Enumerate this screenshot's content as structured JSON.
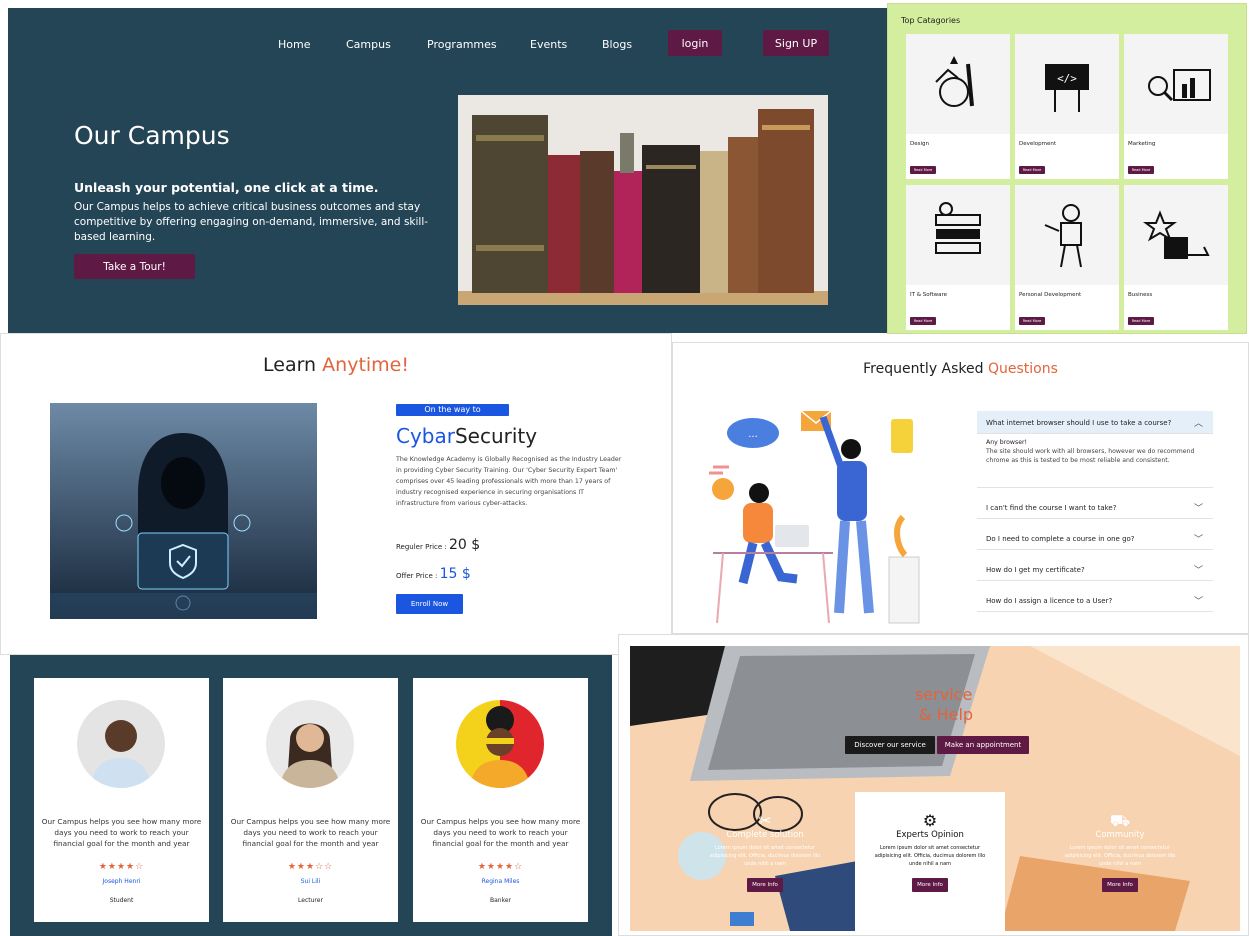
{
  "hero": {
    "nav": [
      "Home",
      "Campus",
      "Programmes",
      "Events",
      "Blogs"
    ],
    "login": "login",
    "signup": "Sign UP",
    "title": "Our Campus",
    "tagline": "Unleash your potential, one click at a time.",
    "description": "Our Campus helps to achieve critical business outcomes and stay competitive by offering engaging on-demand, immersive, and skill-based learning.",
    "cta": "Take a Tour!"
  },
  "categories": {
    "title": "Top Catagories",
    "items": [
      {
        "label": "Design",
        "button": "Read More"
      },
      {
        "label": "Development",
        "button": "Read More"
      },
      {
        "label": "Marketing",
        "button": "Read More"
      },
      {
        "label": "IT & Software",
        "button": "Read More"
      },
      {
        "label": "Personal Development",
        "button": "Read More"
      },
      {
        "label": "Business",
        "button": "Read More"
      }
    ]
  },
  "learn": {
    "title_a": "Learn ",
    "title_b": "Anytime!",
    "pill": "On the way to",
    "course_a": "Cybar",
    "course_b": "Security",
    "description": "The Knowledge Academy is Globally Recognised as the Industry Leader in providing Cyber Security Training. Our 'Cyber Security Expert Team' comprises over 45 leading professionals with more than 17 years of industry recognised experience in securing organisations IT infrastructure from various cyber-attacks.",
    "regular_label": "Reguler Price : ",
    "regular_value": "20 $",
    "offer_label": "Offer Price : ",
    "offer_value": "15 $",
    "enroll": "Enroll Now"
  },
  "faq": {
    "title_a": "Frequently Asked ",
    "title_b": "Questions",
    "open_q": "What internet browser should I use to take a course?",
    "answer_head": "Any browser!",
    "answer_body": "The site should work with all browsers, however we do recommend chrome as this is tested to be most reliable and consistent.",
    "questions": [
      "I can't find the course I want to take?",
      "Do I need to complete a course in one go?",
      "How do I get my certificate?",
      "How do I assign a licence to a User?"
    ]
  },
  "testimonials": [
    {
      "quote": "Our Campus helps you see how many more days you need to work to reach your financial goal for the month and year",
      "stars": "★★★★☆",
      "name": "Joseph Henri",
      "role": "Student"
    },
    {
      "quote": "Our Campus helps you see how many more days you need to work to reach your financial goal for the month and year",
      "stars": "★★★☆☆",
      "name": "Sui Lili",
      "role": "Lecturer"
    },
    {
      "quote": "Our Campus helps you see how many more days you need to work to reach your financial goal for the month and year",
      "stars": "★★★★☆",
      "name": "Regina Miles",
      "role": "Banker"
    }
  ],
  "service": {
    "title1": "service",
    "title2": "& Help",
    "btn1": "Discover our service",
    "btn2": "Make an appointment",
    "cards": [
      {
        "title": "Complete solution",
        "desc": "Lorem ipsum dolor sit amet consectetur adipisicing elit. Officia, ducimus dolorem illo unde nihil a nam",
        "button": "More Info"
      },
      {
        "title": "Experts Opinion",
        "desc": "Lorem ipsum dolor sit amet consectetur adipisicing elit. Officia, ducimus dolorem illo unde nihil a nam",
        "button": "More Info"
      },
      {
        "title": "Community",
        "desc": "Lorem ipsum dolor sit amet consectetur adipisicing elit. Officia, ducimus dolorem illo unde nihil a nam",
        "button": "More Info"
      }
    ]
  }
}
